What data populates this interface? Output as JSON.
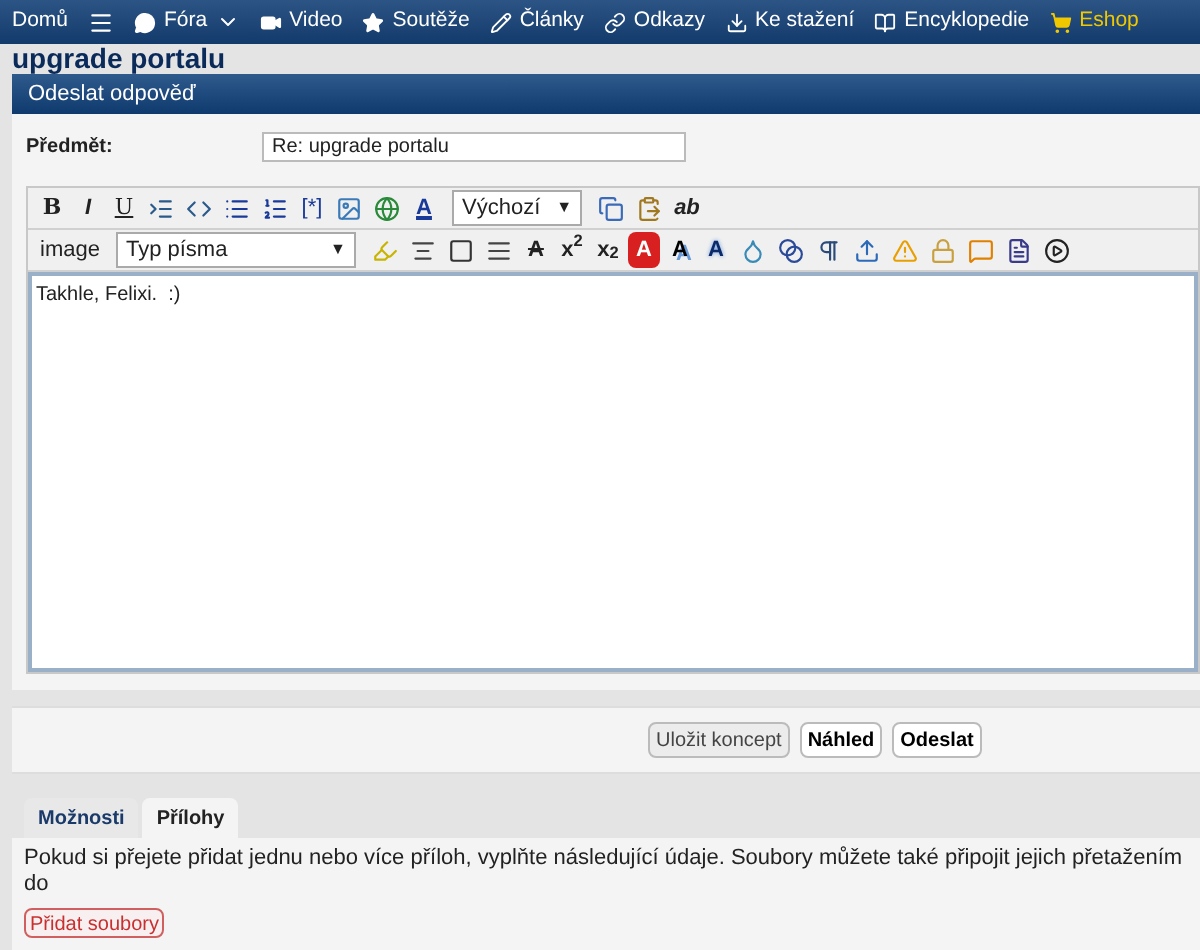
{
  "nav": [
    {
      "label": "Domů",
      "kind": "text",
      "selected": false
    },
    {
      "kind": "icon",
      "selected": false
    },
    {
      "label": "Fóra",
      "kind": "dropdown",
      "selected": false
    },
    {
      "label": "Video",
      "kind": "text",
      "selected": false
    },
    {
      "label": "Soutěže",
      "kind": "text",
      "selected": false
    },
    {
      "label": "Články",
      "kind": "text",
      "selected": false
    },
    {
      "label": "Odkazy",
      "kind": "text",
      "selected": false
    },
    {
      "label": "Ke stažení",
      "kind": "text",
      "selected": false
    },
    {
      "label": "Encyklopedie",
      "kind": "text",
      "selected": false
    },
    {
      "label": "Eshop",
      "kind": "text",
      "selected": true
    }
  ],
  "page_title": "upgrade portalu",
  "panel_title": "Odeslat odpověď",
  "subject": {
    "label": "Předmět:",
    "value": "Re: upgrade portalu"
  },
  "toolbar_rows": [
    [
      {
        "kind": "bold",
        "text": "B"
      },
      {
        "kind": "italic",
        "text": "I"
      },
      {
        "kind": "underline",
        "text": "U"
      },
      {
        "kind": "icon"
      },
      {
        "kind": "icon"
      },
      {
        "kind": "icon"
      },
      {
        "kind": "icon"
      },
      {
        "kind": "plain",
        "text": "[*]"
      },
      {
        "kind": "icon"
      },
      {
        "kind": "icon"
      },
      {
        "kind": "fontcolor",
        "text": "A"
      },
      {
        "kind": "select",
        "text": "Výchozí",
        "arrow": "▼"
      },
      {
        "kind": "icon"
      },
      {
        "kind": "icon"
      },
      {
        "kind": "italic",
        "text": "ab"
      }
    ],
    [
      {
        "kind": "label",
        "text": "image"
      },
      {
        "kind": "select",
        "text": "Typ písma",
        "arrow": "▼"
      },
      {
        "kind": "icon"
      },
      {
        "kind": "icon"
      },
      {
        "kind": "icon"
      },
      {
        "kind": "icon"
      },
      {
        "kind": "strike",
        "text": "A"
      },
      {
        "kind": "script",
        "text": "x$^{2}$"
      },
      {
        "kind": "script",
        "text": "x$_{2}$"
      },
      {
        "kind": "redletter",
        "text": "A"
      },
      {
        "kind": "shadowletter",
        "text": "A"
      },
      {
        "kind": "blueletter",
        "text": "A"
      },
      {
        "kind": "icon"
      },
      {
        "kind": "icon"
      },
      {
        "kind": "icon"
      },
      {
        "kind": "icon"
      },
      {
        "kind": "icon"
      },
      {
        "kind": "icon"
      },
      {
        "kind": "icon"
      },
      {
        "kind": "icon"
      },
      {
        "kind": "icon"
      }
    ]
  ],
  "message": "Takhle, Felixi.  :)",
  "buttons": [
    {
      "label": "Uložit koncept",
      "primary": false
    },
    {
      "label": "Náhled",
      "primary": true
    },
    {
      "label": "Odeslat",
      "primary": true
    }
  ],
  "tabs": [
    {
      "label": "Možnosti",
      "selected": false
    },
    {
      "label": "Přílohy",
      "selected": true
    }
  ],
  "attachments_text": "Pokud si přejete přidat jednu nebo více příloh, vyplňte následující údaje. Soubory můžete také připojit jejich přetažením do",
  "add_files_button": "Přidat soubory"
}
